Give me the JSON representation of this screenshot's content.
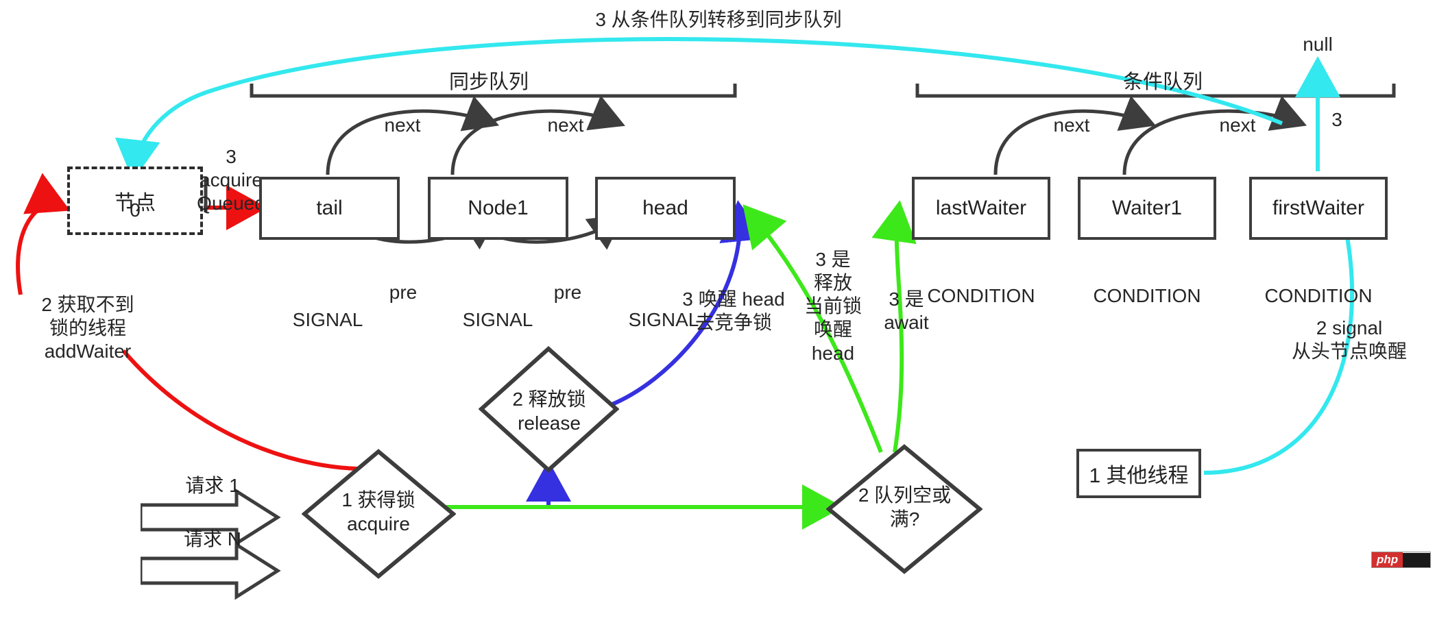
{
  "diagram": {
    "title_sync_queue": "同步队列",
    "title_condition_queue": "条件队列",
    "transfer_label": "3 从条件队列转移到同步队列",
    "null_label": "null",
    "null_step": "3"
  },
  "sync_queue": {
    "group_label": "同步队列",
    "nodes": [
      {
        "label": "tail",
        "state": "SIGNAL"
      },
      {
        "label": "Node1",
        "state": "SIGNAL"
      },
      {
        "label": "head",
        "state": "SIGNAL"
      }
    ],
    "next_labels": [
      "next",
      "next"
    ],
    "pre_labels": [
      "pre",
      "pre"
    ]
  },
  "condition_queue": {
    "group_label": "条件队列",
    "nodes": [
      {
        "label": "lastWaiter",
        "state": "CONDITION"
      },
      {
        "label": "Waiter1",
        "state": "CONDITION"
      },
      {
        "label": "firstWaiter",
        "state": "CONDITION"
      }
    ],
    "next_labels": [
      "next",
      "next"
    ]
  },
  "pending_node": {
    "label": "节点",
    "waitstatus": "0",
    "enqueue_label": "3\nacquire\nQueued"
  },
  "annotations": {
    "add_waiter": "2 获取不到\n锁的线程\naddWaiter",
    "wake_head": "3 唤醒 head\n去竞争锁",
    "release_current_lock": "3 是\n释放\n当前锁\n唤醒\nhead",
    "await": "3 是\nawait",
    "signal_from_head": "2 signal\n从头节点唤醒"
  },
  "flow": {
    "requests": [
      "请求 1",
      "请求 N"
    ],
    "acquire_diamond": "1 获得锁\nacquire",
    "release_diamond": "2 释放锁\nrelease",
    "queue_full_diamond": "2 队列空或\n满?",
    "other_thread_box": "1 其他线程"
  },
  "watermark": {
    "text": "php"
  },
  "colors": {
    "stroke": "#3d3d3d",
    "red": "#ee1111",
    "cyan": "#33e8ee",
    "green": "#3de81a",
    "blue": "#3530e0",
    "text": "#262626"
  }
}
